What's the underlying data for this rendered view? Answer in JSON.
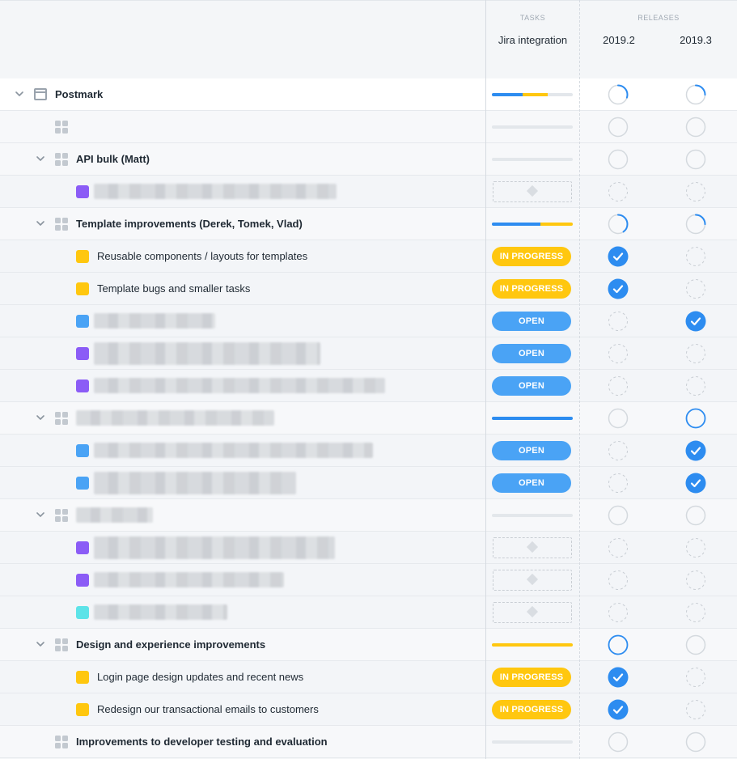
{
  "header": {
    "tasks_label": "TASKS",
    "releases_label": "RELEASES",
    "task_column": "Jira integration",
    "releases": [
      "2019.2",
      "2019.3"
    ]
  },
  "status_labels": {
    "in_progress": "IN PROGRESS",
    "open": "OPEN"
  },
  "colors": {
    "blue": "#4aa3f5",
    "purple": "#8b5cf6",
    "yellow": "#ffc70f",
    "cyan": "#5de3e8",
    "progress_blue": "#2d8cf0",
    "progress_yellow": "#ffc70f"
  },
  "rows": [
    {
      "type": "root",
      "label": "Postmark",
      "progress": [
        {
          "color": "blue",
          "frac": 0.38
        },
        {
          "color": "yellow",
          "frac": 0.31
        }
      ],
      "releases": [
        "progress-0.3",
        "progress-0.25"
      ]
    },
    {
      "type": "group-blur",
      "level": 1,
      "progress": [],
      "releases": [
        "empty",
        "empty"
      ]
    },
    {
      "type": "group",
      "level": 1,
      "label": "API bulk (Matt)",
      "chevron": true,
      "progress": [],
      "releases": [
        "empty",
        "empty"
      ]
    },
    {
      "type": "task-blur",
      "color": "purple",
      "task": "placeholder",
      "releases": [
        "dashed",
        "dashed"
      ]
    },
    {
      "type": "group",
      "level": 1,
      "label": "Template improvements (Derek, Tomek, Vlad)",
      "chevron": true,
      "progress": [
        {
          "color": "blue",
          "frac": 0.6
        },
        {
          "color": "yellow",
          "frac": 0.4
        }
      ],
      "releases": [
        "progress-0.4",
        "progress-0.25"
      ]
    },
    {
      "type": "task",
      "color": "yellow",
      "label": "Reusable components / layouts for templates",
      "task": "in_progress",
      "releases": [
        "check",
        "dashed"
      ]
    },
    {
      "type": "task",
      "color": "yellow",
      "label": "Template bugs and smaller tasks",
      "task": "in_progress",
      "releases": [
        "check",
        "dashed"
      ]
    },
    {
      "type": "task-blur",
      "color": "blue",
      "task": "open",
      "releases": [
        "dashed",
        "check"
      ]
    },
    {
      "type": "task-blur",
      "color": "purple",
      "task": "open",
      "tall": true,
      "releases": [
        "dashed",
        "dashed"
      ]
    },
    {
      "type": "task-blur",
      "color": "purple",
      "task": "open",
      "releases": [
        "dashed",
        "dashed"
      ]
    },
    {
      "type": "group-blur",
      "level": 1,
      "chevron": true,
      "progress": [
        {
          "color": "blue",
          "frac": 1
        }
      ],
      "releases": [
        "empty",
        "ring"
      ]
    },
    {
      "type": "task-blur",
      "color": "blue",
      "task": "open",
      "releases": [
        "dashed",
        "check"
      ]
    },
    {
      "type": "task-blur",
      "color": "blue",
      "task": "open",
      "tall": true,
      "releases": [
        "dashed",
        "check"
      ]
    },
    {
      "type": "group-blur",
      "level": 1,
      "chevron": true,
      "progress": [],
      "releases": [
        "empty",
        "empty"
      ]
    },
    {
      "type": "task-blur",
      "color": "purple",
      "task": "placeholder",
      "tall": true,
      "releases": [
        "dashed",
        "dashed"
      ]
    },
    {
      "type": "task-blur",
      "color": "purple",
      "task": "placeholder",
      "releases": [
        "dashed",
        "dashed"
      ]
    },
    {
      "type": "task-blur",
      "color": "cyan",
      "task": "placeholder",
      "releases": [
        "dashed",
        "dashed"
      ]
    },
    {
      "type": "group",
      "level": 1,
      "label": "Design and experience improvements",
      "chevron": true,
      "progress": [
        {
          "color": "yellow",
          "frac": 1
        }
      ],
      "releases": [
        "ring",
        "empty"
      ]
    },
    {
      "type": "task",
      "color": "yellow",
      "label": "Login page design updates and recent news",
      "task": "in_progress",
      "releases": [
        "check",
        "dashed"
      ]
    },
    {
      "type": "task",
      "color": "yellow",
      "label": "Redesign our transactional emails to customers",
      "task": "in_progress",
      "releases": [
        "check",
        "dashed"
      ]
    },
    {
      "type": "group",
      "level": 1,
      "label": "Improvements to developer testing and evaluation",
      "chevron": false,
      "progress": [],
      "releases": [
        "empty",
        "empty"
      ]
    }
  ]
}
